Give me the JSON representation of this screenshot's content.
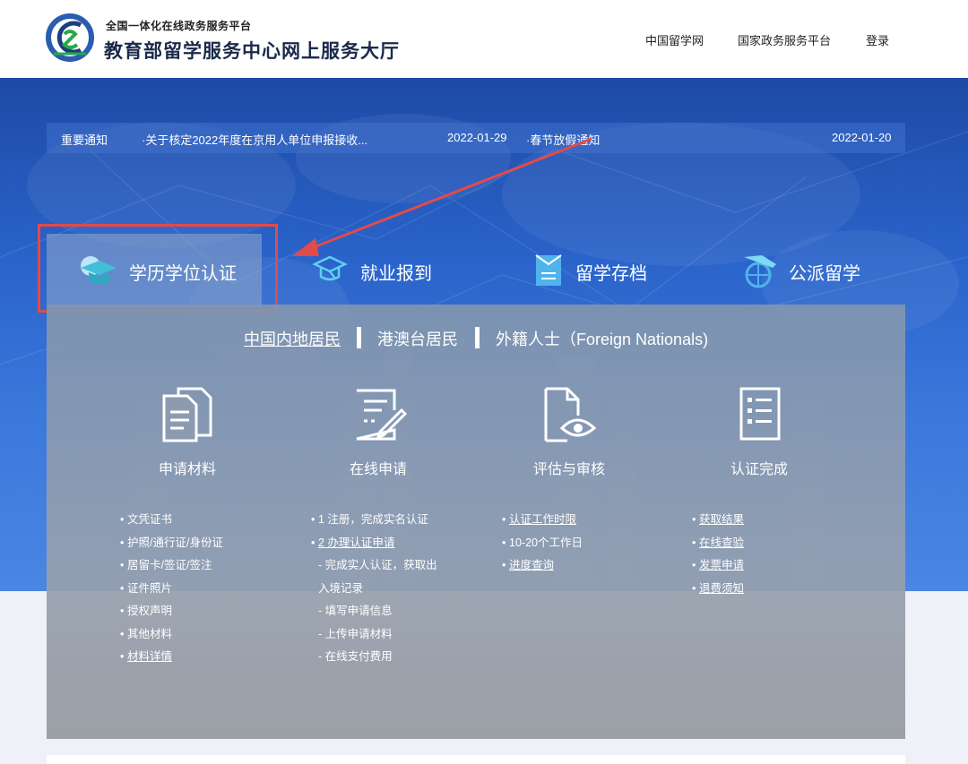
{
  "header": {
    "sub_title": "全国一体化在线政务服务平台",
    "title": "教育部留学服务中心网上服务大厅",
    "nav": [
      "中国留学网",
      "国家政务服务平台",
      "登录"
    ]
  },
  "notice": {
    "label": "重要通知",
    "items": [
      {
        "text": "·关于核定2022年度在京用人单位申报接收...",
        "date": "2022-01-29"
      },
      {
        "text": "·春节放假通知",
        "date": "2022-01-20"
      }
    ]
  },
  "tabs": [
    {
      "label": "学历学位认证",
      "icon": "graduation-cap-icon"
    },
    {
      "label": "就业报到",
      "icon": "cap-outline-icon"
    },
    {
      "label": "留学存档",
      "icon": "archive-icon"
    },
    {
      "label": "公派留学",
      "icon": "plane-globe-icon"
    }
  ],
  "resident_tabs": [
    "中国内地居民",
    "港澳台居民",
    "外籍人士（Foreign Nationals)"
  ],
  "steps": [
    {
      "title": "申请材料",
      "icon": "documents-icon"
    },
    {
      "title": "在线申请",
      "icon": "form-edit-icon"
    },
    {
      "title": "评估与审核",
      "icon": "doc-eye-icon"
    },
    {
      "title": "认证完成",
      "icon": "checklist-icon"
    }
  ],
  "lists": {
    "materials": [
      "文凭证书",
      "护照/通行证/身份证",
      "居留卡/签证/签注",
      "证件照片",
      "授权声明",
      "其他材料",
      "材料详情"
    ],
    "online": [
      "1 注册，完成实名认证",
      "2 办理认证申请",
      "- 完成实人认证，获取出",
      "入境记录",
      "- 填写申请信息",
      "- 上传申请材料",
      "- 在线支付费用"
    ],
    "review": [
      "认证工作时限",
      "10-20个工作日",
      "进度查询"
    ],
    "complete": [
      "获取结果",
      "在线查验",
      "发票申请",
      "退费须知"
    ]
  },
  "colors": {
    "highlight": "#e34a4a",
    "title": "#1a2a4a"
  }
}
